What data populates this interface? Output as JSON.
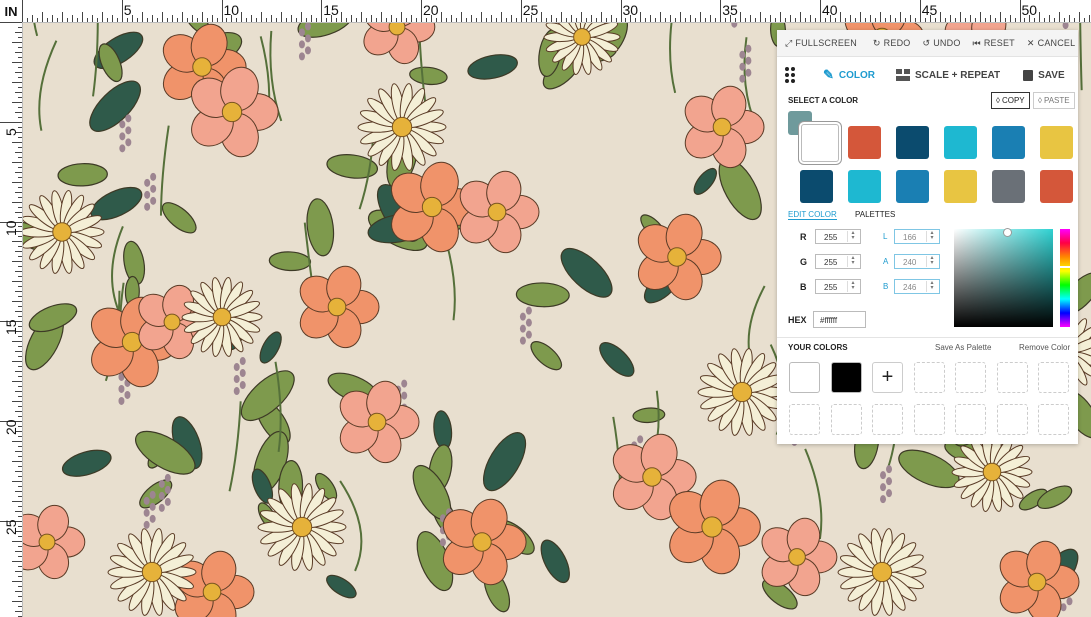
{
  "ruler": {
    "unit": "IN",
    "top_labels": [
      "5",
      "10",
      "15",
      "20",
      "25",
      "30",
      "35",
      "40",
      "45",
      "50"
    ],
    "left_labels": [
      "5",
      "10",
      "15",
      "20",
      "25"
    ]
  },
  "toolbar": {
    "fullscreen": "FULLSCREEN",
    "redo": "REDO",
    "undo": "UNDO",
    "reset": "RESET",
    "cancel": "CANCEL"
  },
  "tabs": {
    "color": "COLOR",
    "scale_repeat": "SCALE + REPEAT",
    "save": "SAVE"
  },
  "select_color": {
    "heading": "SELECT A COLOR",
    "copy": "COPY",
    "paste": "PASTE",
    "current": "#6f9a9c",
    "swatches": [
      "#ffffff",
      "#d4573a",
      "#0b4b6e",
      "#1eb8d1",
      "#1a7fb3",
      "#e8c542",
      "#0b4b6e",
      "#1eb8d1",
      "#1a7fb3",
      "#e8c542",
      "#6a7077",
      "#d4573a"
    ]
  },
  "edit": {
    "edit_color": "EDIT COLOR",
    "palettes": "PALETTES",
    "r_label": "R",
    "r": "255",
    "g_label": "G",
    "g": "255",
    "b_label": "B",
    "b": "255",
    "l_label": "L",
    "l": "166",
    "a_label": "A",
    "a": "240",
    "bb_label": "B",
    "bb": "246",
    "hex_label": "HEX",
    "hex": "#ffffff"
  },
  "your_colors": {
    "heading": "YOUR COLORS",
    "save_palette": "Save As Palette",
    "remove": "Remove Color",
    "colors": [
      "#ffffff",
      "#000000"
    ]
  },
  "pattern": {
    "background": "#e8dfcf",
    "flower_colors": [
      "#f0936a",
      "#f2a48f",
      "#f4efd6",
      "#e8a85a"
    ],
    "leaf_color": "#7e9a4d",
    "leaf_dark": "#2f5a4a"
  }
}
